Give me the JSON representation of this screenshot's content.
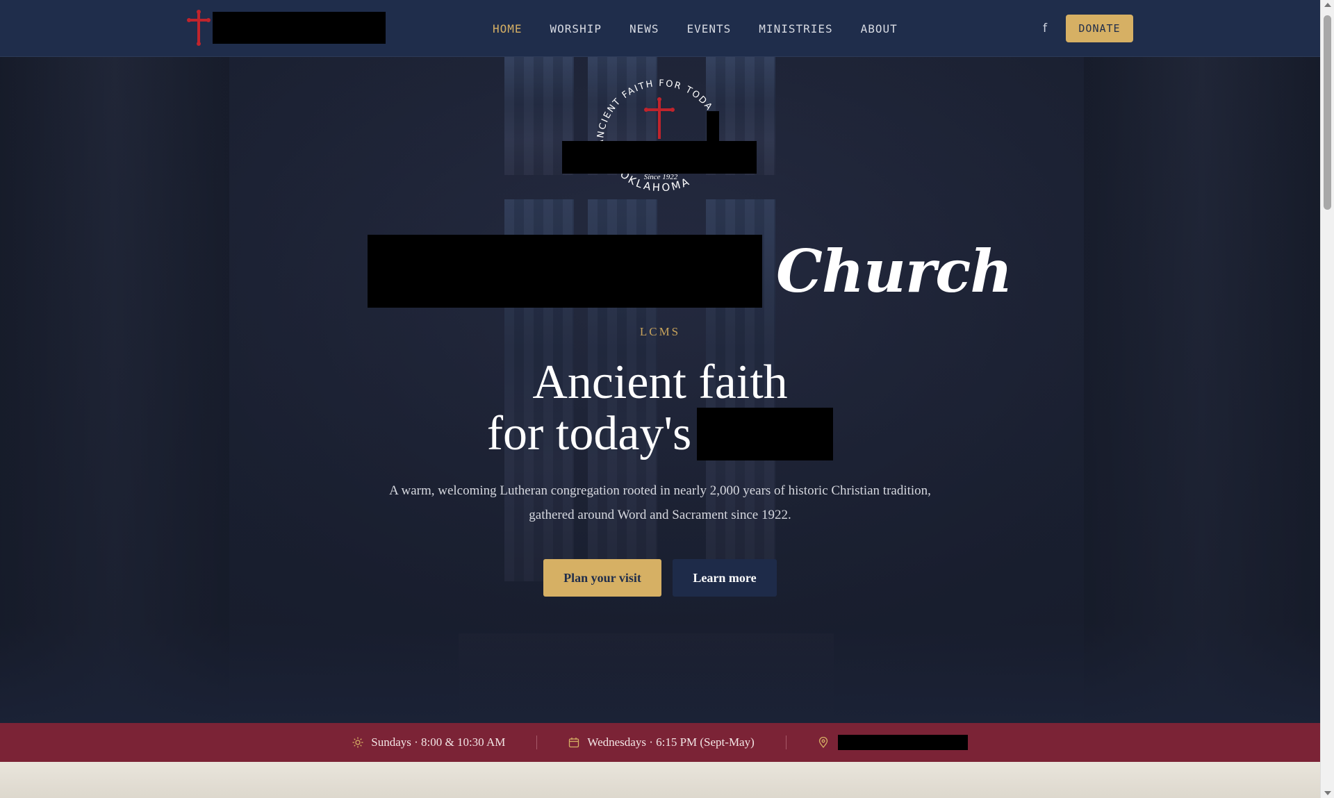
{
  "nav": {
    "links": [
      {
        "label": "HOME",
        "active": true
      },
      {
        "label": "WORSHIP"
      },
      {
        "label": "NEWS"
      },
      {
        "label": "EVENTS"
      },
      {
        "label": "MINISTRIES"
      },
      {
        "label": "ABOUT"
      }
    ],
    "social_icon": "facebook-icon",
    "donate_label": "DONATE"
  },
  "emblem": {
    "arc_text": "ANCIENT FAITH FOR TODAY'S",
    "since": "Since 1922",
    "bottom_text": "OKLAHOMA"
  },
  "hero": {
    "title_word": "Church",
    "affiliation": "LCMS",
    "headline_line1": "Ancient faith",
    "headline_line2": "for today's",
    "subtitle": "A warm, welcoming Lutheran congregation rooted in nearly 2,000 years of historic Christian tradition, gathered around Word and Sacrament since 1922.",
    "primary_cta": "Plan your visit",
    "secondary_cta": "Learn more"
  },
  "info_strip": {
    "sunday": "Sundays · 8:00 & 10:30 AM",
    "wednesday": "Wednesdays · 6:15 PM (Sept-May)",
    "icons": [
      "sun-icon",
      "calendar-icon",
      "map-pin-icon"
    ]
  },
  "colors": {
    "navy": "#1f2d4b",
    "gold": "#d6b064",
    "crimson": "#7b2336",
    "cross_red": "#c0242c"
  }
}
